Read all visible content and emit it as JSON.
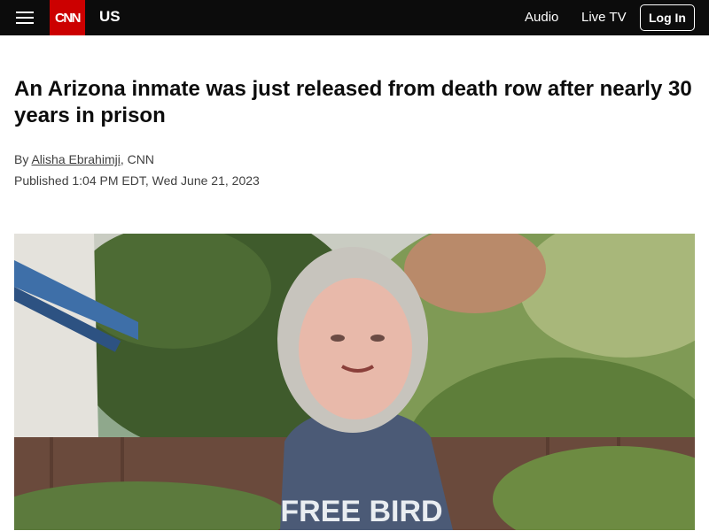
{
  "header": {
    "logo_text": "CNN",
    "section": "US",
    "nav": [
      {
        "label": "Audio"
      },
      {
        "label": "Live TV"
      }
    ],
    "login_label": "Log In"
  },
  "article": {
    "headline": "An Arizona inmate was just released from death row after nearly 30 years in prison",
    "byline_prefix": "By",
    "author": "Alisha Ebrahimji",
    "byline_suffix": ", CNN",
    "published": "Published 1:04 PM EDT, Wed June 21, 2023",
    "image": {
      "shirt_text": "FREE BIRD"
    }
  },
  "colors": {
    "header_bg": "#0c0c0c",
    "brand_red": "#cc0000"
  }
}
